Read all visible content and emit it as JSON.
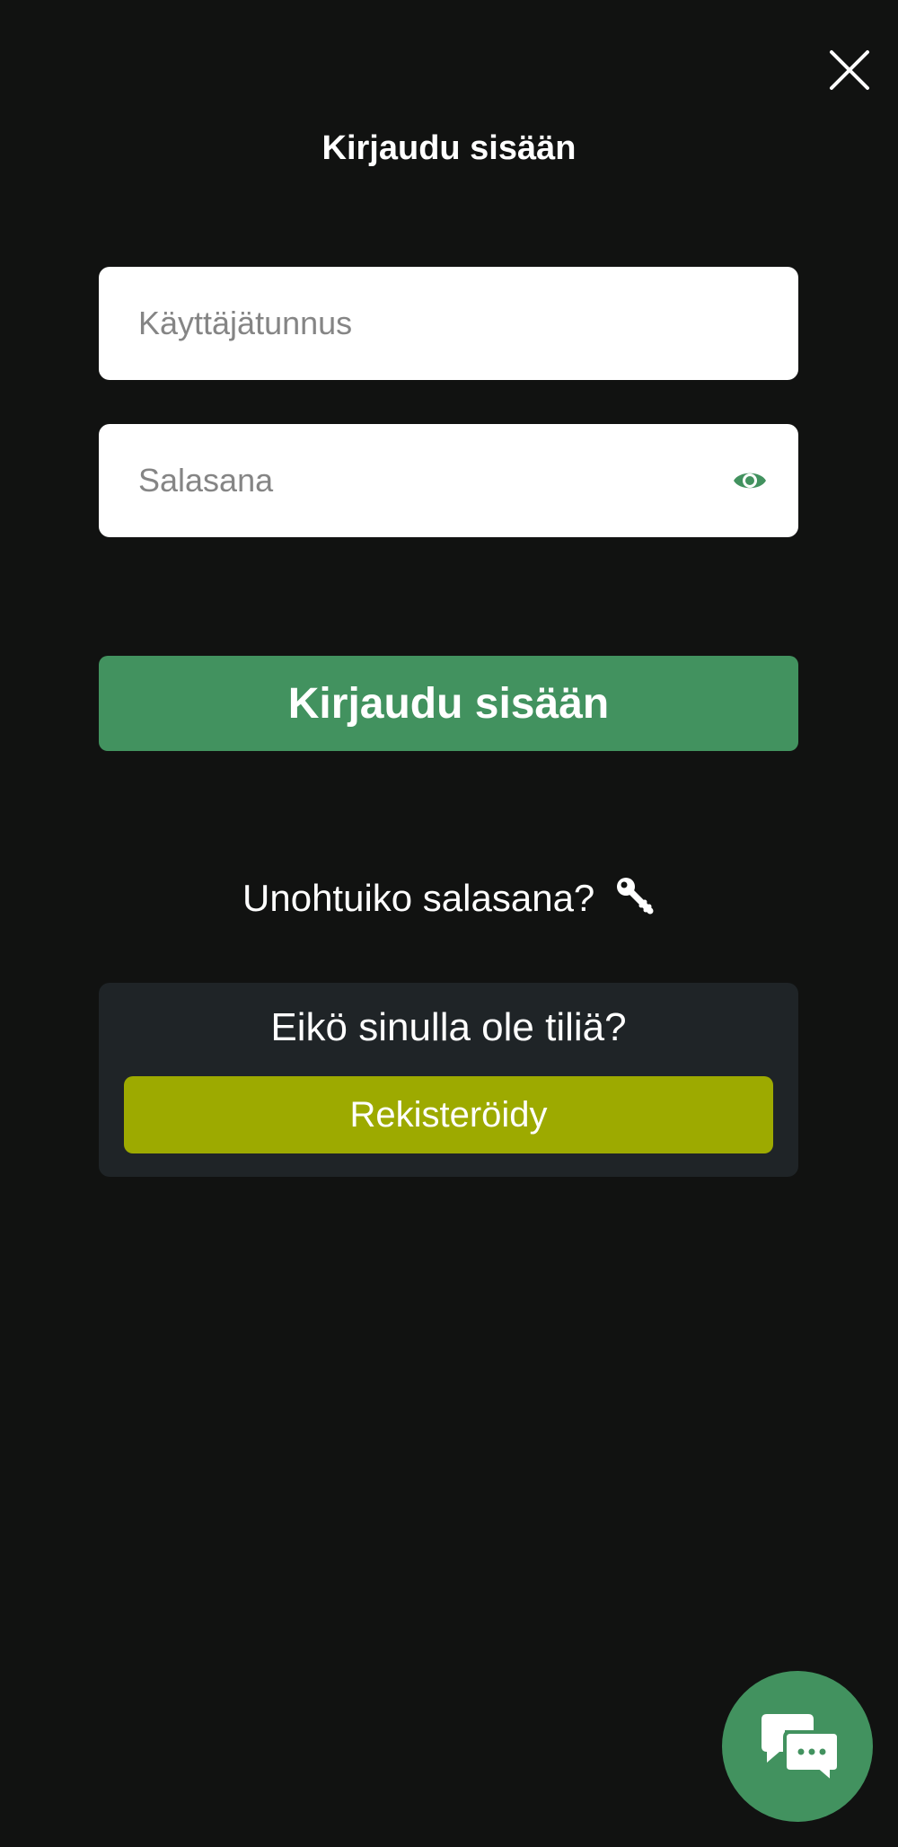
{
  "title": "Kirjaudu sisään",
  "icons": {
    "close": "close-icon",
    "eye": "eye-icon",
    "key": "key-icon",
    "chat": "chat-icon"
  },
  "form": {
    "username_placeholder": "Käyttäjätunnus",
    "username_value": "",
    "password_placeholder": "Salasana",
    "password_value": "",
    "submit_label": "Kirjaudu sisään"
  },
  "forgot_password": "Unohtuiko salasana?",
  "register": {
    "question": "Eikö sinulla ole tiliä?",
    "button_label": "Rekisteröidy"
  },
  "colors": {
    "background": "#111211",
    "primary_green": "#42925f",
    "register_yellow_green": "#9daa00",
    "register_panel": "#1f2427"
  }
}
